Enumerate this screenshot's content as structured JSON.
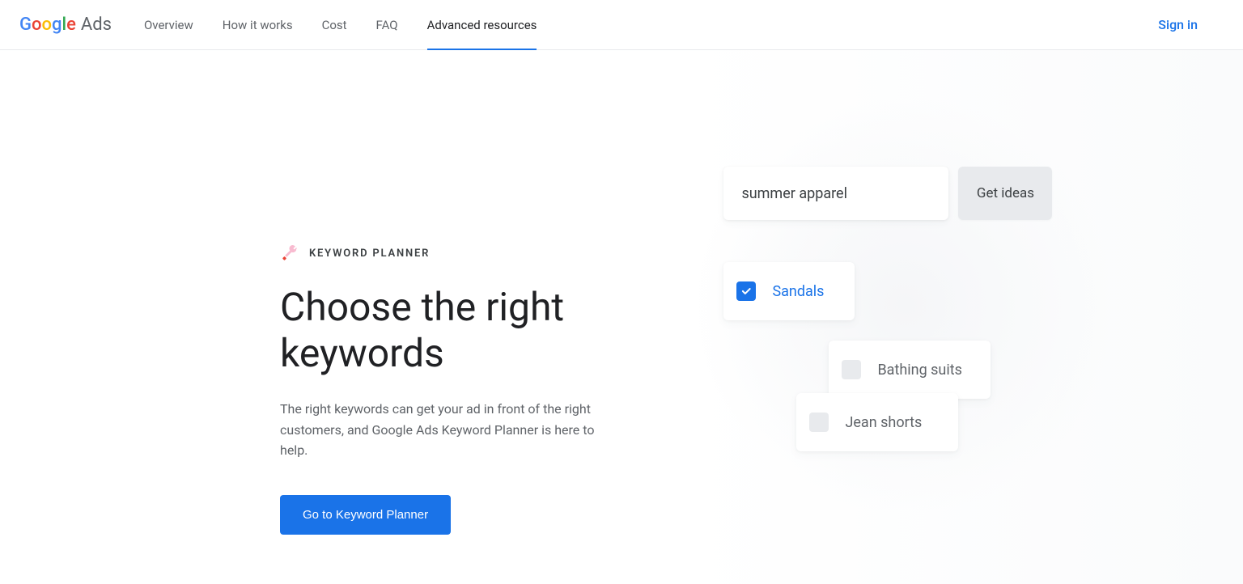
{
  "brand": {
    "ads": "Ads"
  },
  "nav": {
    "items": [
      {
        "label": "Overview"
      },
      {
        "label": "How it works"
      },
      {
        "label": "Cost"
      },
      {
        "label": "FAQ"
      },
      {
        "label": "Advanced resources"
      }
    ],
    "signin": "Sign in"
  },
  "hero": {
    "eyebrow": "KEYWORD PLANNER",
    "title": "Choose the right keywords",
    "description": "The right keywords can get your ad in front of the right customers, and Google Ads Keyword Planner is here to help.",
    "cta": "Go to Keyword Planner"
  },
  "illustration": {
    "search_value": "summer apparel",
    "get_ideas": "Get ideas",
    "chips": [
      {
        "label": "Sandals",
        "checked": true
      },
      {
        "label": "Bathing suits",
        "checked": false
      },
      {
        "label": "Jean shorts",
        "checked": false
      }
    ]
  }
}
